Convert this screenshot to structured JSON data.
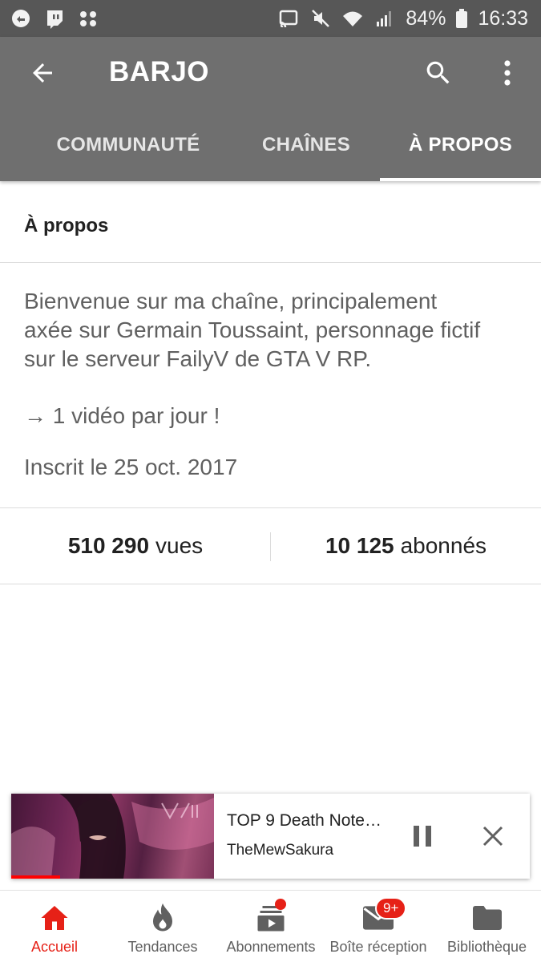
{
  "status_bar": {
    "battery": "84%",
    "time": "16:33"
  },
  "app_bar": {
    "title": "BARJO",
    "tabs": [
      {
        "label": "COMMUNAUTÉ",
        "active": false
      },
      {
        "label": "CHAÎNES",
        "active": false
      },
      {
        "label": "À PROPOS",
        "active": true
      }
    ]
  },
  "about": {
    "heading": "À propos",
    "description_lines": [
      "Bienvenue sur ma chaîne, principalement",
      "axée sur Germain Toussaint, personnage fictif",
      "sur le serveur FailyV de GTA V RP."
    ],
    "tagline": "→ 1 vidéo par jour !",
    "joined": "Inscrit le 25 oct. 2017",
    "stats": {
      "views_count": "510 290",
      "views_label": "vues",
      "subscribers_count": "10 125",
      "subscribers_label": "abonnés"
    }
  },
  "mini_player": {
    "title": "TOP 9 Death Note…",
    "channel": "TheMewSakura",
    "progress": 0.24
  },
  "bottom_nav": {
    "items": [
      {
        "label": "Accueil",
        "icon": "home-icon",
        "active": true
      },
      {
        "label": "Tendances",
        "icon": "flame-icon",
        "active": false
      },
      {
        "label": "Abonnements",
        "icon": "subscriptions-icon",
        "active": false,
        "dot": true
      },
      {
        "label": "Boîte réception",
        "icon": "inbox-icon",
        "active": false,
        "badge": "9+"
      },
      {
        "label": "Bibliothèque",
        "icon": "folder-icon",
        "active": false
      }
    ]
  },
  "colors": {
    "app_bar": "#6f6f6f",
    "status_bar": "#575757",
    "accent_red": "#e62117"
  }
}
